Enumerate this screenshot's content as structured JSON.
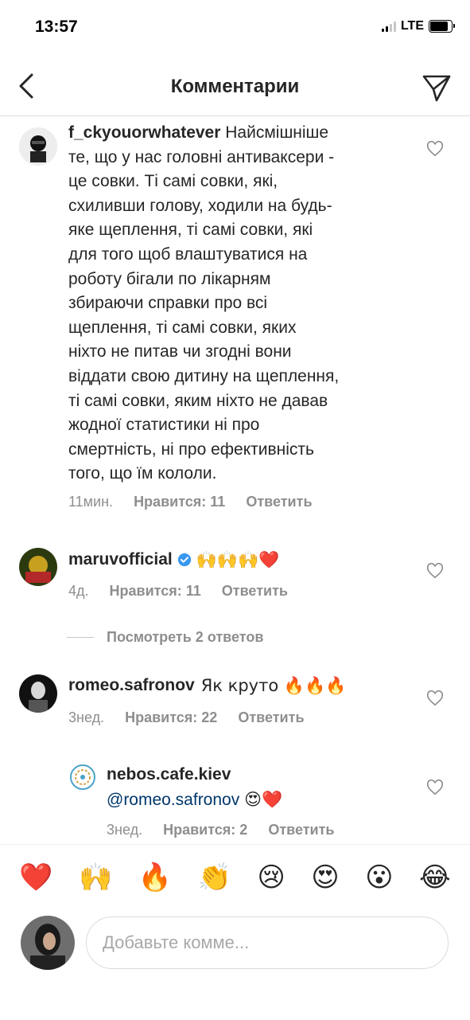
{
  "status": {
    "time": "13:57",
    "network": "LTE",
    "battery_level": 0.85
  },
  "header": {
    "title": "Комментарии",
    "back_icon": "chevron-left-icon",
    "share_icon": "paper-plane-icon"
  },
  "comments": [
    {
      "username": "f_ckyouorwhatever",
      "lines": [
        "Найсмішніше",
        "те, що у нас головні антиваксери -",
        "це совки. Ті самі совки, які,",
        "схиливши голову, ходили на будь-",
        "яке щеплення, ті самі совки, які",
        "для того щоб влаштуватися на",
        "роботу бігали по лікарням",
        "збираючи справки про всі",
        "щеплення, ті самі совки, яких",
        "ніхто не питав чи згодні вони",
        "віддати свою дитину на щеплення,",
        "ті самі совки, яким ніхто не давав",
        "жодної статистики ні про",
        "смертність, ні про ефективність",
        "того, що їм кололи."
      ],
      "time": "11мин.",
      "likes": "Нравится: 11",
      "reply": "Ответить"
    },
    {
      "username": "maruvofficial",
      "verified": true,
      "text": "🙌🙌🙌❤️",
      "time": "4д.",
      "likes": "Нравится: 11",
      "reply": "Ответить"
    },
    {
      "view_replies": "Посмотреть 2 ответов"
    },
    {
      "username": "romeo.safronov",
      "text": "Як круто 🔥🔥🔥",
      "time": "3нед.",
      "likes": "Нравится: 22",
      "reply": "Ответить"
    },
    {
      "username": "nebos.cafe.kiev",
      "mention": "@romeo.safronov",
      "text": "😍❤️",
      "time": "3нед.",
      "likes": "Нравится: 2",
      "reply": "Ответить"
    }
  ],
  "quick_emojis": [
    "❤️",
    "🙌",
    "🔥",
    "👏",
    "😢",
    "😍",
    "😮",
    "😂"
  ],
  "composer": {
    "placeholder": "Добавьте комме..."
  },
  "colors": {
    "text": "#262626",
    "muted": "#8e8e8e",
    "verified": "#3897f0",
    "mention": "#00376b"
  }
}
